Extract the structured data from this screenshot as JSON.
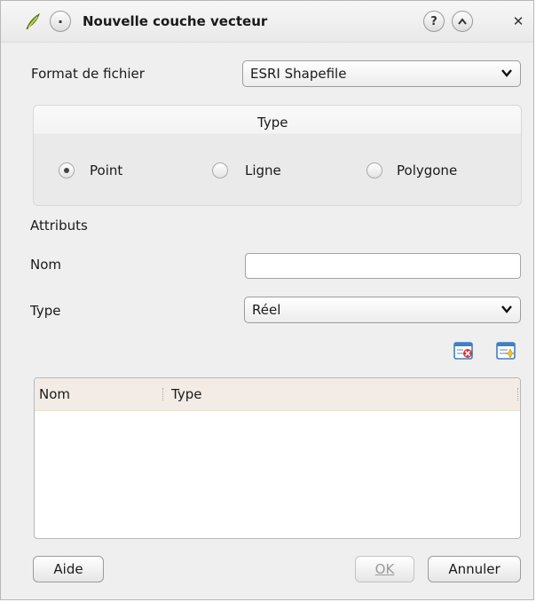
{
  "window": {
    "title": "Nouvelle couche vecteur"
  },
  "titlebar": {
    "help_symbol": "?",
    "shade_symbol": "^",
    "close_symbol": "✕"
  },
  "format": {
    "label": "Format de fichier",
    "value": "ESRI Shapefile"
  },
  "type_group": {
    "title": "Type",
    "options": [
      {
        "label": "Point",
        "checked": true
      },
      {
        "label": "Ligne",
        "checked": false
      },
      {
        "label": "Polygone",
        "checked": false
      }
    ]
  },
  "attributes": {
    "section_label": "Attributs",
    "name_label": "Nom",
    "name_value": "",
    "type_label": "Type",
    "type_value": "Réel"
  },
  "table": {
    "columns": [
      "Nom",
      "Type"
    ],
    "rows": []
  },
  "buttons": {
    "help": "Aide",
    "ok": "OK",
    "cancel": "Annuler"
  },
  "icons": {
    "app": "qgis-leaf-icon",
    "delete_attribute": "delete-attribute-icon",
    "add_attribute": "add-attribute-icon"
  },
  "colors": {
    "table_header_bg": "#f3ece6",
    "icon_blue": "#3f7fc4",
    "icon_red": "#d23a3a"
  }
}
